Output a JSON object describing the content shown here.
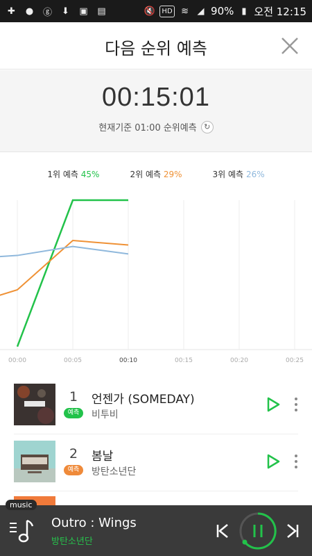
{
  "statusbar": {
    "battery": "90%",
    "time": "오전 12:15",
    "left_icons": [
      "plus-icon",
      "messenger-icon",
      "g-icon",
      "download-icon",
      "image-icon",
      "data-icon"
    ],
    "right_icons": [
      "mute-icon",
      "hd-icon",
      "wifi-icon",
      "signal-icon",
      "battery-icon"
    ]
  },
  "header": {
    "title": "다음 순위 예측"
  },
  "timer": {
    "value": "00:15:01",
    "basis": "현재기준 01:00 순위예측"
  },
  "legend": [
    {
      "label": "1위 예측",
      "pct": "45%",
      "color": "#22c24a"
    },
    {
      "label": "2위 예측",
      "pct": "29%",
      "color": "#ef9135"
    },
    {
      "label": "3위 예측",
      "pct": "26%",
      "color": "#8fb8dc"
    }
  ],
  "chart_data": {
    "type": "line",
    "x": [
      "00:00",
      "00:05",
      "00:10",
      "00:15",
      "00:20",
      "00:25"
    ],
    "ylim": [
      0,
      100
    ],
    "grid": true,
    "series": [
      {
        "name": "1위 예측",
        "color": "#22c24a",
        "values": [
          2,
          100,
          100
        ]
      },
      {
        "name": "2위 예측",
        "color": "#ef9135",
        "values": [
          40,
          73,
          70
        ]
      },
      {
        "name": "3위 예측",
        "color": "#8fb8dc",
        "values": [
          63,
          69,
          64
        ]
      }
    ]
  },
  "ranking": [
    {
      "rank": "1",
      "badge": "예측",
      "badge_color": "#22c24a",
      "song": "언젠가 (SOMEDAY)",
      "artist": "비투비",
      "cover": "dark"
    },
    {
      "rank": "2",
      "badge": "예측",
      "badge_color": "#ef8a3a",
      "song": "봄날",
      "artist": "방탄소년단",
      "cover": "teal"
    }
  ],
  "player": {
    "tag": "music",
    "title": "Outro : Wings",
    "artist": "방탄소년단"
  }
}
